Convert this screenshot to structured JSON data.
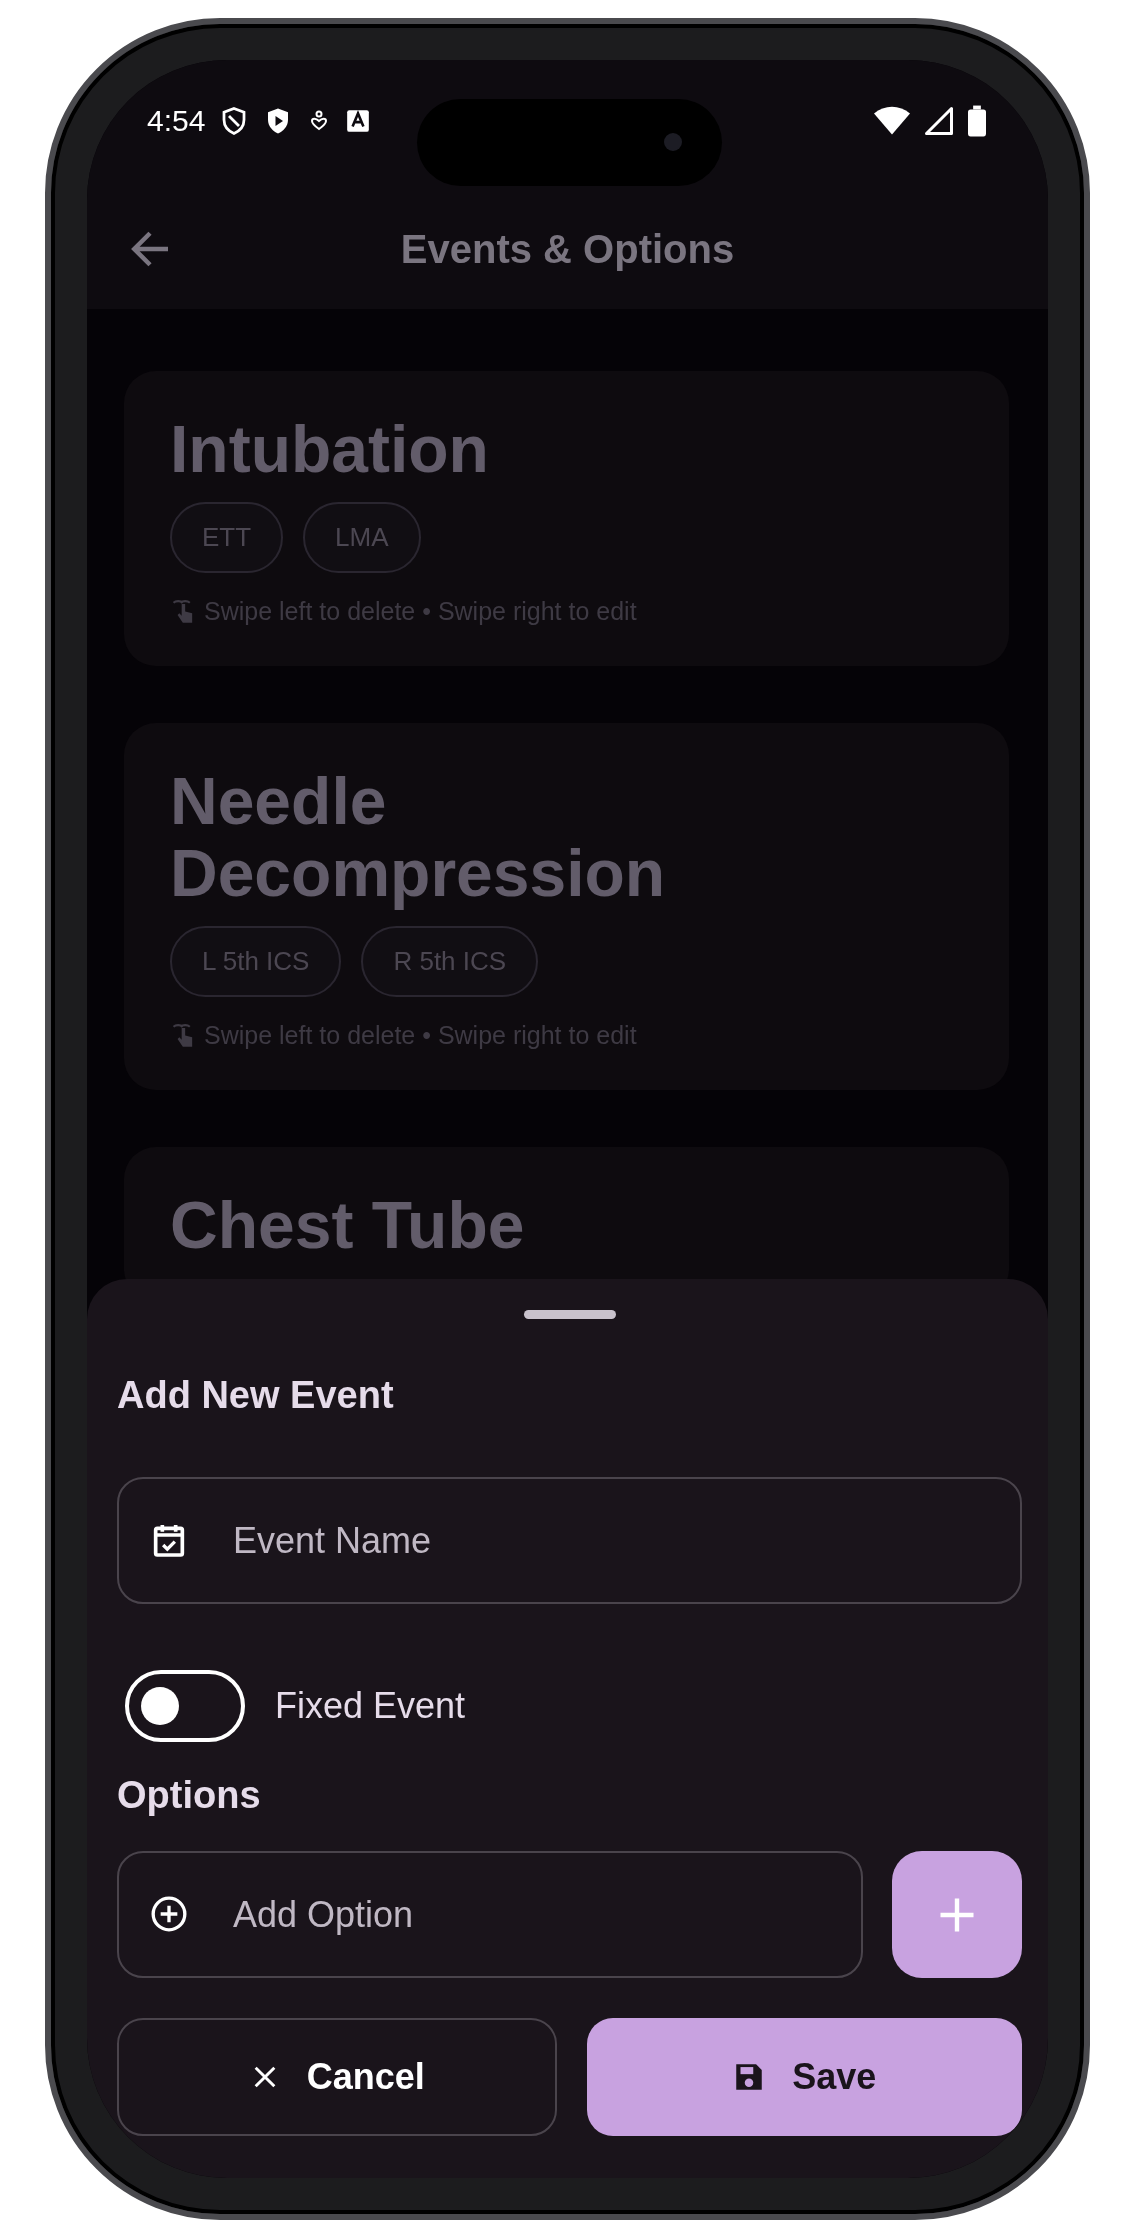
{
  "status_bar": {
    "time": "4:54"
  },
  "header": {
    "title": "Events & Options"
  },
  "events": [
    {
      "name": "Intubation",
      "options": [
        "ETT",
        "LMA"
      ],
      "hint": "Swipe left to delete • Swipe right to edit"
    },
    {
      "name": "Needle Decompression",
      "options": [
        "L 5th ICS",
        "R 5th ICS"
      ],
      "hint": "Swipe left to delete • Swipe right to edit"
    },
    {
      "name": "Chest Tube"
    }
  ],
  "sheet": {
    "title": "Add New Event",
    "event_name": {
      "placeholder": "Event Name"
    },
    "fixed_event": {
      "label": "Fixed Event",
      "on": false
    },
    "options_title": "Options",
    "option_field": {
      "placeholder": "Add Option"
    },
    "buttons": [
      {
        "kind": "cancel",
        "label": "Cancel"
      },
      {
        "kind": "save",
        "label": "Save"
      }
    ]
  }
}
